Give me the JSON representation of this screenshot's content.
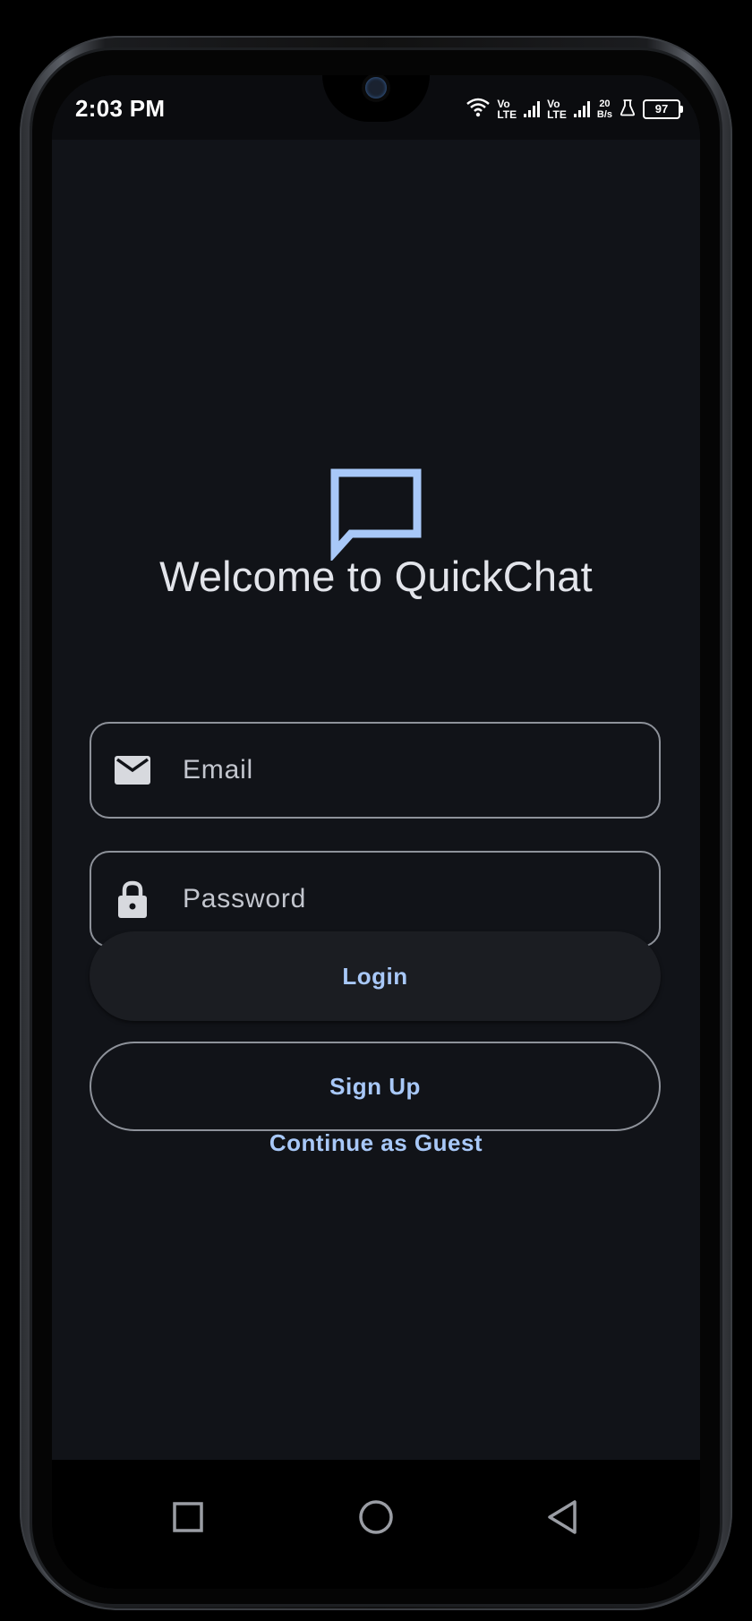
{
  "status_bar": {
    "time": "2:03 PM",
    "sim1": {
      "top": "Vo",
      "bottom": "LTE"
    },
    "sim2": {
      "top": "Vo",
      "bottom": "LTE"
    },
    "speed": {
      "value": "20",
      "unit": "B/s"
    },
    "battery": "97"
  },
  "login": {
    "welcome_title": "Welcome to QuickChat",
    "email_placeholder": "Email",
    "password_placeholder": "Password",
    "login_label": "Login",
    "signup_label": "Sign Up",
    "guest_label": "Continue as Guest"
  },
  "icons": {
    "logo": "chat-bubble-icon",
    "email": "mail-icon",
    "password": "lock-icon"
  },
  "nav": [
    "recent-apps",
    "home",
    "back"
  ],
  "colors": {
    "accent": "#a8c8f8",
    "background": "#111318",
    "text": "#e2e4ea",
    "outline": "#8e929a"
  }
}
